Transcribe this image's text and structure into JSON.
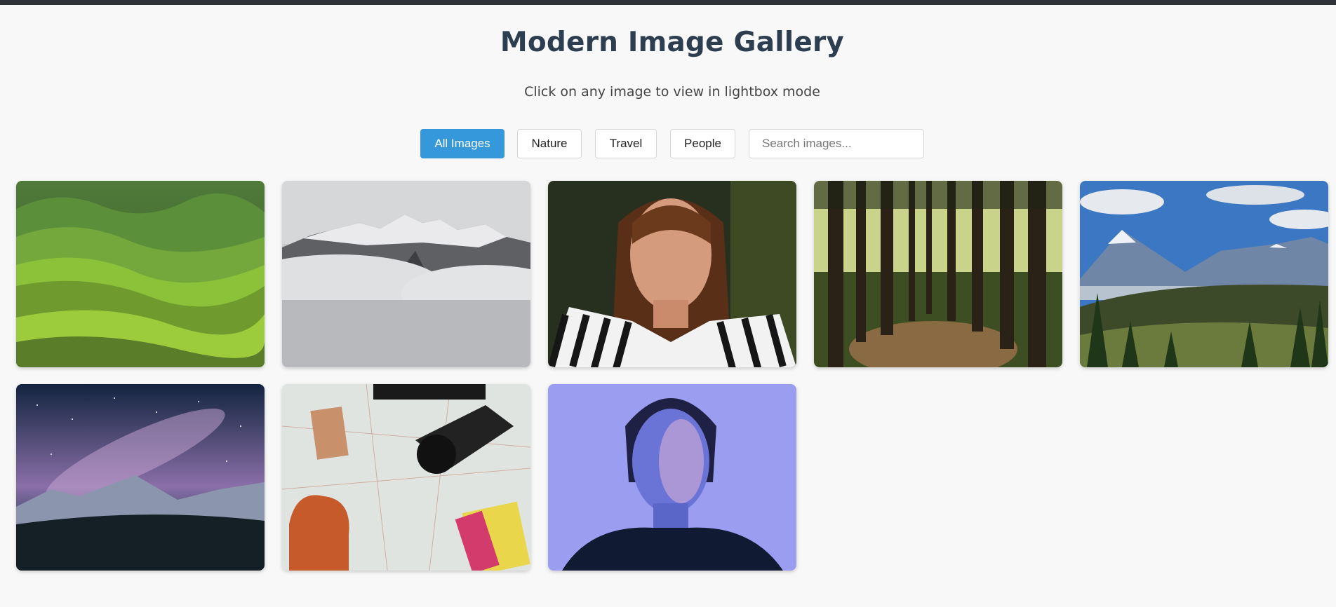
{
  "page": {
    "title": "Modern Image Gallery",
    "subtitle": "Click on any image to view in lightbox mode"
  },
  "filters": {
    "all": "All Images",
    "nature": "Nature",
    "travel": "Travel",
    "people": "People",
    "active": "All Images"
  },
  "search": {
    "placeholder": "Search images...",
    "value": ""
  },
  "colors": {
    "accent": "#3498db",
    "title": "#2c3e50"
  },
  "gallery": [
    {
      "subject": "green rolling hills"
    },
    {
      "subject": "snowy mountain in clouds"
    },
    {
      "subject": "woman portrait with striped shirt"
    },
    {
      "subject": "forest path"
    },
    {
      "subject": "mountain valley with pines"
    },
    {
      "subject": "starry night over mountains"
    },
    {
      "subject": "map, camera, bag and notebook flatlay"
    },
    {
      "subject": "woman portrait in blue light"
    }
  ]
}
